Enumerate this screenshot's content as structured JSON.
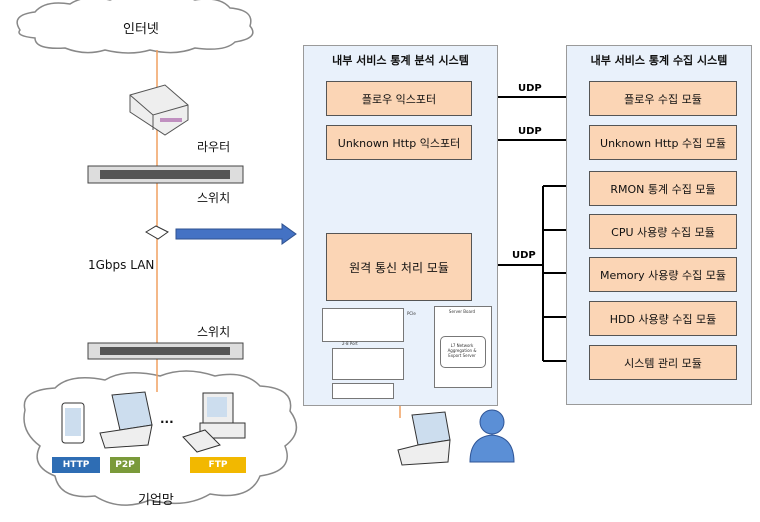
{
  "internet_label": "인터넷",
  "router_label": "라우터",
  "switch1_label": "스위치",
  "switch2_label": "스위치",
  "lan_label": "1Gbps LAN",
  "enterprise_label": "기업망",
  "ellipsis": "...",
  "protocols": [
    {
      "label": "HTTP",
      "color": "#2e6db4"
    },
    {
      "label": "P2P",
      "color": "#7a9a3a"
    },
    {
      "label": "FTP",
      "color": "#f2b800"
    }
  ],
  "analysis_system": {
    "title": "내부 서비스 통계 분석 시스템",
    "modules": [
      "플로우 익스포터",
      "Unknown Http 익스포터",
      "원격 통신 처리 모듈"
    ],
    "hardware": {
      "server_board": "Server Board",
      "pcie": "PCIe",
      "server": "L7 Network Aggregation & Export Server",
      "ports": "2-8 Port"
    }
  },
  "collection_system": {
    "title": "내부 서비스 통계 수집 시스템",
    "modules": [
      "플로우 수집 모듈",
      "Unknown Http 수집 모듈",
      "RMON 통계 수집 모듈",
      "CPU 사용량 수집 모듈",
      "Memory 사용량 수집 모듈",
      "HDD 사용량 수집 모듈",
      "시스템 관리 모듈"
    ]
  },
  "udp_label": "UDP",
  "colors": {
    "module_fill": "#fbd5b5",
    "panel_fill": "#e9f1fb",
    "link": "#f0a060",
    "arrow": "#4472c4"
  }
}
